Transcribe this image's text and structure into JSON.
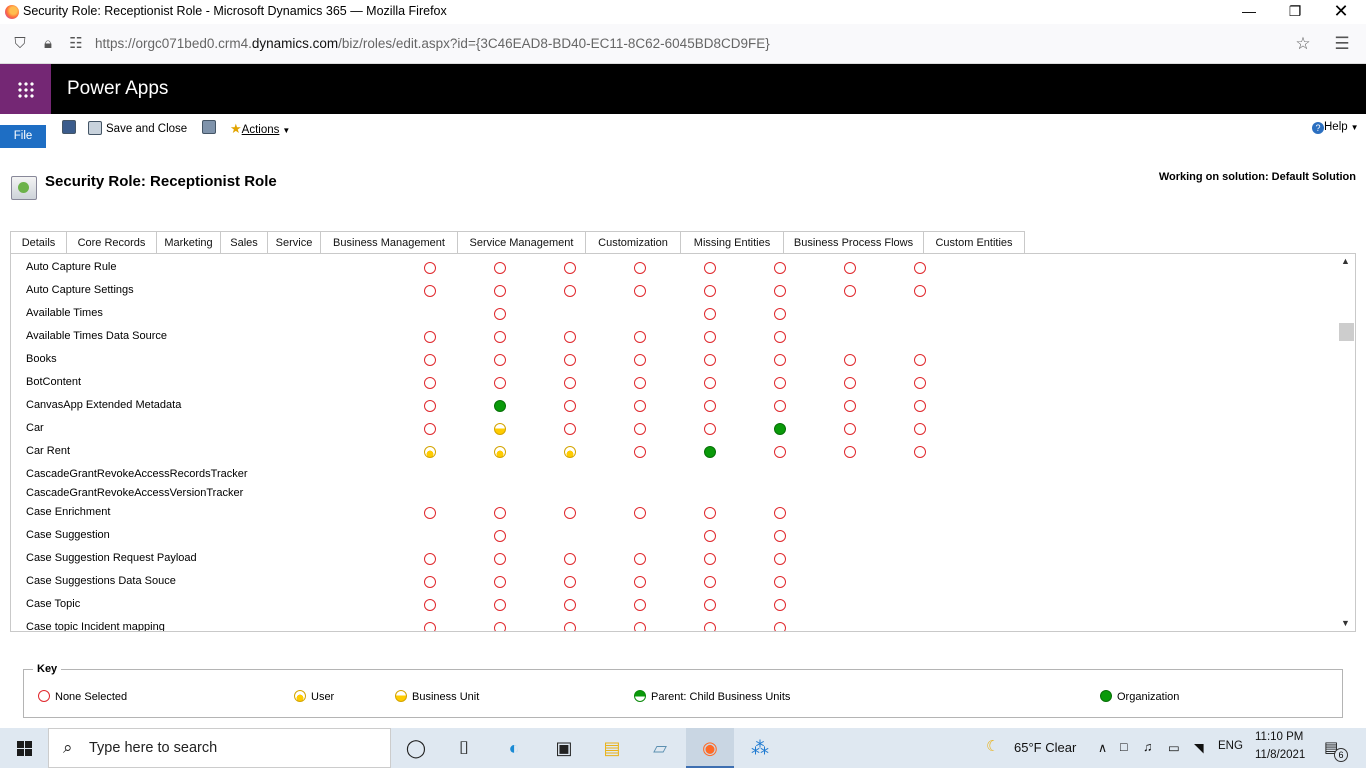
{
  "browser": {
    "window_title": "Security Role: Receptionist Role - Microsoft Dynamics 365 — Mozilla Firefox",
    "url_prefix": "https://orgc071bed0.crm4.",
    "url_domain": "dynamics.com",
    "url_suffix": "/biz/roles/edit.aspx?id={3C46EAD8-BD40-EC11-8C62-6045BD8CD9FE}"
  },
  "app": {
    "name": "Power Apps"
  },
  "toolbar": {
    "file_label": "File",
    "save_close_label": "Save and Close",
    "actions_label": "Actions",
    "help_label": "Help"
  },
  "page": {
    "title": "Security Role: Receptionist Role",
    "solution": "Working on solution: Default Solution"
  },
  "tabs": [
    "Details",
    "Core Records",
    "Marketing",
    "Sales",
    "Service",
    "Business Management",
    "Service Management",
    "Customization",
    "Missing Entities",
    "Business Process Flows",
    "Custom Entities"
  ],
  "entities": [
    {
      "name": "Auto Capture Rule",
      "levels": [
        "none",
        "none",
        "none",
        "none",
        "none",
        "none",
        "none",
        "none"
      ]
    },
    {
      "name": "Auto Capture Settings",
      "levels": [
        "none",
        "none",
        "none",
        "none",
        "none",
        "none",
        "none",
        "none"
      ]
    },
    {
      "name": "Available Times",
      "levels": [
        "",
        "none",
        "",
        "",
        "none",
        "none",
        "",
        ""
      ]
    },
    {
      "name": "Available Times Data Source",
      "levels": [
        "none",
        "none",
        "none",
        "none",
        "none",
        "none",
        "",
        ""
      ]
    },
    {
      "name": "Books",
      "levels": [
        "none",
        "none",
        "none",
        "none",
        "none",
        "none",
        "none",
        "none"
      ]
    },
    {
      "name": "BotContent",
      "levels": [
        "none",
        "none",
        "none",
        "none",
        "none",
        "none",
        "none",
        "none"
      ]
    },
    {
      "name": "CanvasApp Extended Metadata",
      "levels": [
        "none",
        "org",
        "none",
        "none",
        "none",
        "none",
        "none",
        "none"
      ]
    },
    {
      "name": "Car",
      "levels": [
        "none",
        "bu",
        "none",
        "none",
        "none",
        "org",
        "none",
        "none"
      ]
    },
    {
      "name": "Car Rent",
      "levels": [
        "user",
        "user",
        "user",
        "none",
        "org",
        "none",
        "none",
        "none"
      ]
    },
    {
      "name": "CascadeGrantRevokeAccessRecordsTracker",
      "levels": [
        "",
        "",
        "",
        "",
        "",
        "",
        "",
        ""
      ]
    },
    {
      "name": "CascadeGrantRevokeAccessVersionTracker",
      "levels": [
        "",
        "",
        "",
        "",
        "",
        "",
        "",
        ""
      ]
    },
    {
      "name": "Case Enrichment",
      "levels": [
        "none",
        "none",
        "none",
        "none",
        "none",
        "none",
        "",
        ""
      ]
    },
    {
      "name": "Case Suggestion",
      "levels": [
        "",
        "none",
        "",
        "",
        "none",
        "none",
        "",
        ""
      ]
    },
    {
      "name": "Case Suggestion Request Payload",
      "levels": [
        "none",
        "none",
        "none",
        "none",
        "none",
        "none",
        "",
        ""
      ]
    },
    {
      "name": "Case Suggestions Data Souce",
      "levels": [
        "none",
        "none",
        "none",
        "none",
        "none",
        "none",
        "",
        ""
      ]
    },
    {
      "name": "Case Topic",
      "levels": [
        "none",
        "none",
        "none",
        "none",
        "none",
        "none",
        "",
        ""
      ]
    },
    {
      "name": "Case topic Incident mapping",
      "levels": [
        "none",
        "none",
        "none",
        "none",
        "none",
        "none",
        "",
        ""
      ]
    }
  ],
  "key": {
    "title": "Key",
    "items": [
      {
        "label": "None Selected",
        "type": "none"
      },
      {
        "label": "User",
        "type": "user"
      },
      {
        "label": "Business Unit",
        "type": "bu"
      },
      {
        "label": "Parent: Child Business Units",
        "type": "pcbu"
      },
      {
        "label": "Organization",
        "type": "org"
      }
    ]
  },
  "taskbar": {
    "search_placeholder": "Type here to search",
    "weather": "65°F  Clear",
    "language": "ENG",
    "time": "11:10 PM",
    "date": "11/8/2021",
    "notifications": "6"
  }
}
